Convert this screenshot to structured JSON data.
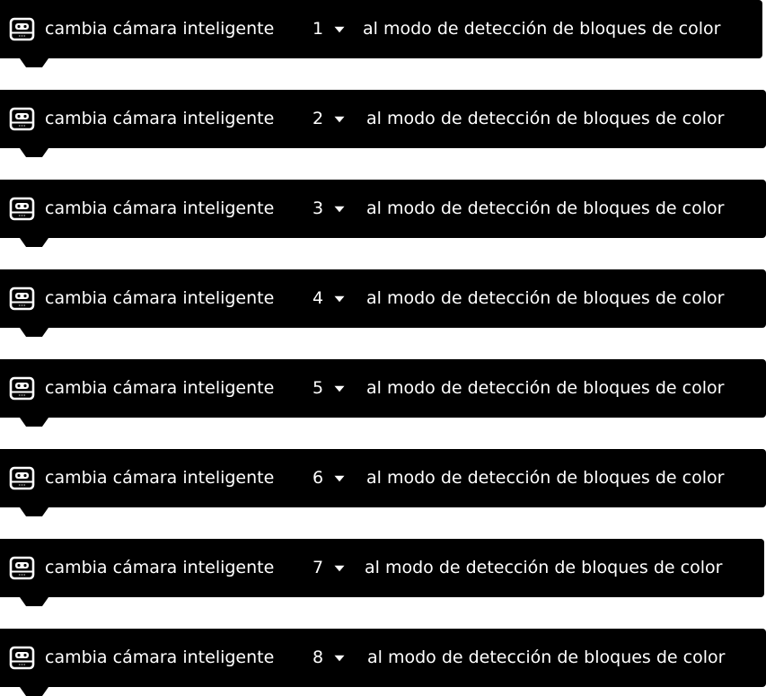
{
  "colors": {
    "block_bg": "#000000",
    "text": "#ffffff",
    "page_bg": "#ffffff"
  },
  "blocks": [
    {
      "icon": "smart-camera-icon",
      "prefix": "cambia cámara inteligente",
      "camera": "1",
      "suffix": "al modo de detección de bloques de color"
    },
    {
      "icon": "smart-camera-icon",
      "prefix": "cambia cámara inteligente",
      "camera": "2",
      "suffix": "al modo de detección de bloques de color"
    },
    {
      "icon": "smart-camera-icon",
      "prefix": "cambia cámara inteligente",
      "camera": "3",
      "suffix": "al modo de detección de bloques de color"
    },
    {
      "icon": "smart-camera-icon",
      "prefix": "cambia cámara inteligente",
      "camera": "4",
      "suffix": "al modo de detección de bloques de color"
    },
    {
      "icon": "smart-camera-icon",
      "prefix": "cambia cámara inteligente",
      "camera": "5",
      "suffix": "al modo de detección de bloques de color"
    },
    {
      "icon": "smart-camera-icon",
      "prefix": "cambia cámara inteligente",
      "camera": "6",
      "suffix": "al modo de detección de bloques de color"
    },
    {
      "icon": "smart-camera-icon",
      "prefix": "cambia cámara inteligente",
      "camera": "7",
      "suffix": "al modo de detección de bloques de color"
    },
    {
      "icon": "smart-camera-icon",
      "prefix": "cambia cámara inteligente",
      "camera": "8",
      "suffix": "al modo de detección de bloques de color"
    }
  ]
}
